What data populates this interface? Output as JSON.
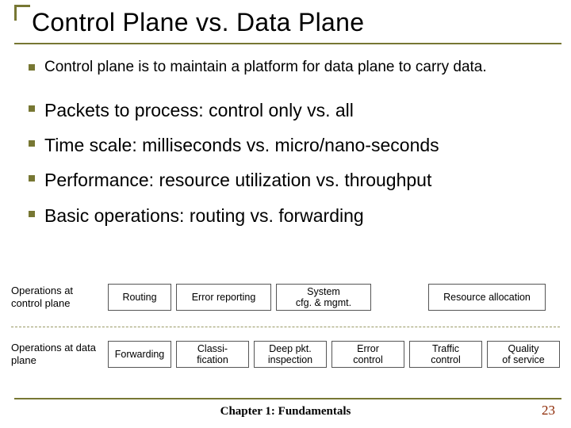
{
  "title": "Control Plane vs. Data Plane",
  "bullets": {
    "b0": "Control plane is to maintain a platform for data plane to carry data.",
    "b1": "Packets to process: control only vs. all",
    "b2": "Time scale: milliseconds vs. micro/nano-seconds",
    "b3": "Performance: resource utilization vs. throughput",
    "b4": "Basic operations: routing vs. forwarding"
  },
  "ops": {
    "row1": {
      "label": "Operations at control plane",
      "boxes": [
        "Routing",
        "Error reporting",
        "System\ncfg. & mgmt.",
        "Resource allocation"
      ]
    },
    "row2": {
      "label": "Operations at data plane",
      "boxes": [
        "Forwarding",
        "Classi-\nfication",
        "Deep pkt.\ninspection",
        "Error\ncontrol",
        "Traffic\ncontrol",
        "Quality\nof service"
      ]
    }
  },
  "footer": {
    "chapter": "Chapter 1: Fundamentals",
    "page": "23"
  }
}
